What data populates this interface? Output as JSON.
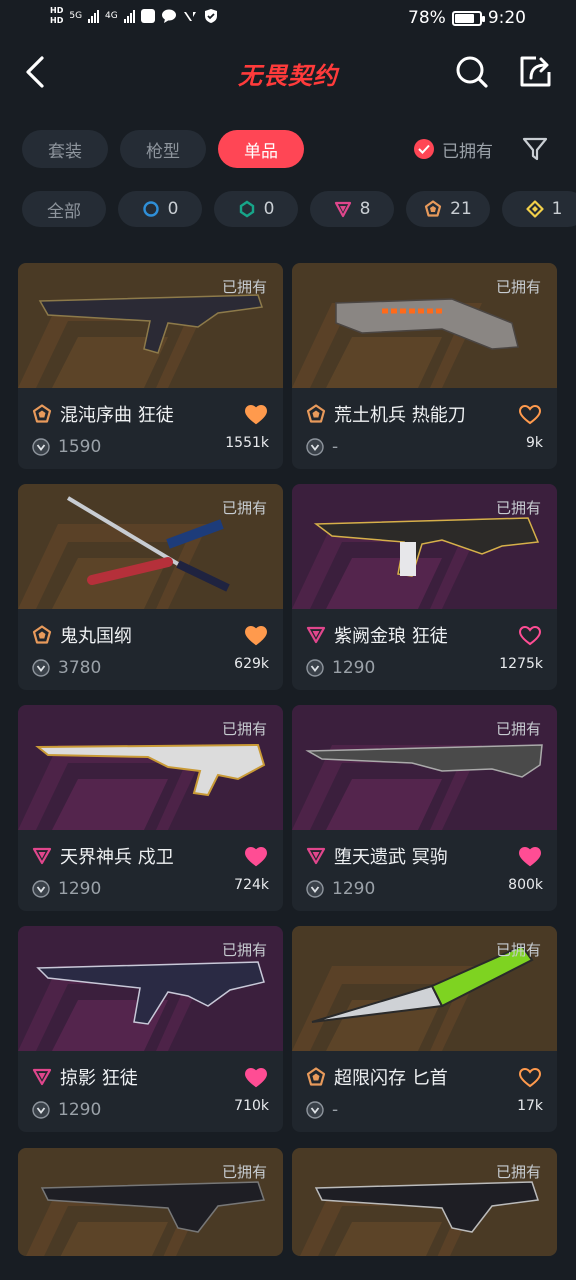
{
  "status_bar": {
    "hd1": "HD",
    "hd2": "HD",
    "net1": "5G",
    "net2": "4G",
    "battery_percent": "78%",
    "battery_level": 0.78,
    "time": "9:20"
  },
  "header": {
    "title": "无畏契约",
    "back_icon": "chevron-left-icon",
    "search_icon": "search-icon",
    "share_icon": "share-icon"
  },
  "tabs": [
    {
      "label": "套装",
      "active": false
    },
    {
      "label": "枪型",
      "active": false
    },
    {
      "label": "单品",
      "active": true
    }
  ],
  "owned_filter": {
    "label": "已拥有",
    "checked": true
  },
  "tier_chips": [
    {
      "label": "全部",
      "count": "",
      "color": ""
    },
    {
      "label": "",
      "count": "0",
      "color": "#2f8fd8",
      "icon": "circle"
    },
    {
      "label": "",
      "count": "0",
      "color": "#17a589",
      "icon": "circle"
    },
    {
      "label": "",
      "count": "8",
      "color": "#e0468c",
      "icon": "triangle"
    },
    {
      "label": "",
      "count": "21",
      "color": "#e89a5b",
      "icon": "pentagon"
    },
    {
      "label": "",
      "count": "1",
      "color": "#f2d04a",
      "icon": "diamond"
    }
  ],
  "colors": {
    "accent": "#ff4655",
    "tier_exclusive": "#e89a5b",
    "tier_premium": "#e0468c",
    "banner_orange": "#4a3a25",
    "banner_purple": "#3b1f3d"
  },
  "items": [
    {
      "owned": "已拥有",
      "name": "混沌序曲 狂徒",
      "tier": "exclusive",
      "price": "1590",
      "likes": "1551k",
      "liked": true,
      "banner": "orange"
    },
    {
      "owned": "已拥有",
      "name": "荒土机兵 热能刀",
      "tier": "exclusive",
      "price": "-",
      "likes": "9k",
      "liked": false,
      "banner": "orange"
    },
    {
      "owned": "已拥有",
      "name": "鬼丸国纲",
      "tier": "exclusive",
      "price": "3780",
      "likes": "629k",
      "liked": true,
      "banner": "orange"
    },
    {
      "owned": "已拥有",
      "name": "紫阙金琅 狂徒",
      "tier": "premium",
      "price": "1290",
      "likes": "1275k",
      "liked": false,
      "banner": "purple"
    },
    {
      "owned": "已拥有",
      "name": "天界神兵 戍卫",
      "tier": "premium",
      "price": "1290",
      "likes": "724k",
      "liked": true,
      "banner": "purple"
    },
    {
      "owned": "已拥有",
      "name": "堕天遗武 冥驹",
      "tier": "premium",
      "price": "1290",
      "likes": "800k",
      "liked": true,
      "banner": "purple"
    },
    {
      "owned": "已拥有",
      "name": "掠影 狂徒",
      "tier": "premium",
      "price": "1290",
      "likes": "710k",
      "liked": true,
      "banner": "purple"
    },
    {
      "owned": "已拥有",
      "name": "超限闪存 匕首",
      "tier": "exclusive",
      "price": "-",
      "likes": "17k",
      "liked": false,
      "banner": "orange"
    },
    {
      "owned": "已拥有",
      "name": "",
      "tier": "exclusive",
      "price": "",
      "likes": "",
      "liked": false,
      "banner": "orange"
    },
    {
      "owned": "已拥有",
      "name": "",
      "tier": "exclusive",
      "price": "",
      "likes": "",
      "liked": false,
      "banner": "orange"
    }
  ]
}
